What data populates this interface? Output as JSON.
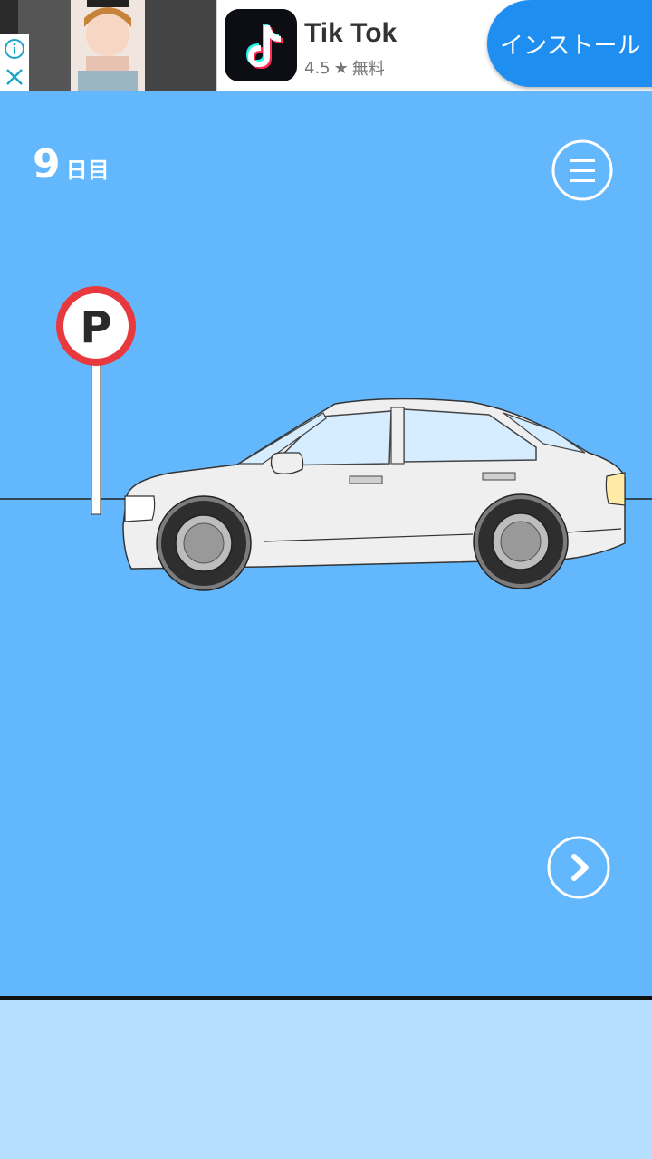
{
  "ad": {
    "app_name": "Tik Tok",
    "rating": "4.5",
    "star": "★",
    "price": "無料",
    "install_label": "インストール",
    "info_icon": "info-icon",
    "close_icon": "close-icon"
  },
  "game": {
    "day_number": "9",
    "day_suffix": "日目",
    "parking_sign_letter": "P",
    "menu_icon": "hamburger-menu-icon",
    "next_icon": "chevron-right-icon"
  },
  "colors": {
    "background": "#63b7fd",
    "bottom_panel": "#b5deff",
    "install_button": "#1e8ff0",
    "sign_ring": "#e8393f"
  }
}
